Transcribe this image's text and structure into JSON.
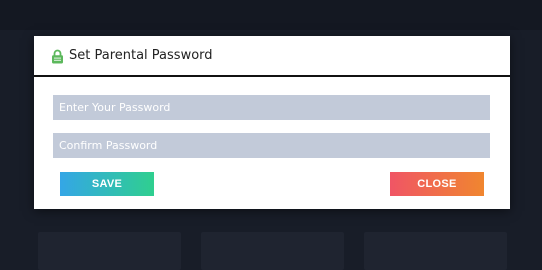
{
  "dialog": {
    "title": "Set Parental Password",
    "icon": "lock-icon",
    "password_placeholder": "Enter Your Password",
    "confirm_placeholder": "Confirm Password",
    "save_label": "SAVE",
    "close_label": "CLOSE"
  },
  "colors": {
    "field_bg": "#c2cad9",
    "save_gradient": [
      "#34a6e6",
      "#2fcf8f"
    ],
    "close_gradient": [
      "#f05565",
      "#f0862f"
    ],
    "lock_icon": "#5cb85c"
  }
}
